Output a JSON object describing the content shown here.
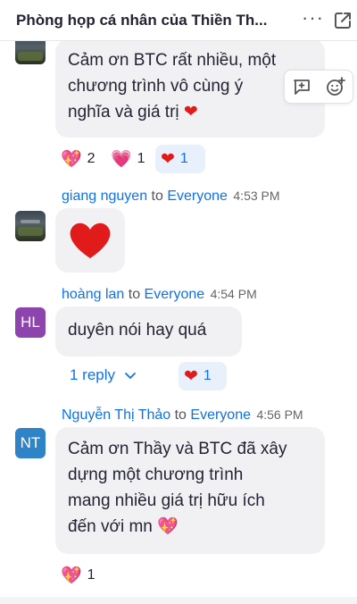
{
  "header": {
    "title": "Phòng họp cá nhân của Thiền Th...",
    "more_icon": "ellipsis-icon",
    "popout_icon": "popout-icon"
  },
  "messages": [
    {
      "text": "Cảm ơn BTC rất nhiều, một chương trình vô cùng ý nghĩa và giá trị",
      "lines": [
        "Cảm ơn BTC rất nhiều, một",
        "chương trình vô cùng ý",
        "nghĩa và giá trị"
      ],
      "end_emoji": "heart",
      "reactions": [
        {
          "emoji": "sparkling-heart",
          "count": "2"
        },
        {
          "emoji": "growing-heart",
          "count": "1"
        },
        {
          "emoji": "red-heart",
          "count": "1",
          "selected": true
        }
      ]
    },
    {
      "sender": "giang nguyen",
      "to": "to",
      "recipient": "Everyone",
      "time": "4:53 PM",
      "avatar": "photo",
      "content_emoji": "red-heart"
    },
    {
      "sender": "hoàng lan",
      "to": "to",
      "recipient": "Everyone",
      "time": "4:54 PM",
      "avatar_initials": "HL",
      "avatar_color": "#8e44ad",
      "text": "duyên nói hay quá",
      "reply_label": "1 reply",
      "reactions": [
        {
          "emoji": "red-heart",
          "count": "1",
          "selected": true
        }
      ]
    },
    {
      "sender": "Nguyễn Thị Thảo",
      "to": "to",
      "recipient": "Everyone",
      "time": "4:56 PM",
      "avatar_initials": "NT",
      "avatar_color": "#2e84c6",
      "text": "Cảm ơn Thầy và BTC đã xây dựng một chương trình mang nhiều giá trị hữu ích đến với mn",
      "lines": [
        "Cảm ơn Thầy và BTC đã xây",
        "dựng một chương trình",
        "mang nhiều giá trị hữu ích",
        "đến với mn"
      ],
      "end_emoji": "sparkling-heart",
      "reactions": [
        {
          "emoji": "sparkling-heart",
          "count": "1"
        }
      ]
    }
  ],
  "colors": {
    "accent": "#0e72ed",
    "bubble": "#f1f1f4",
    "heart": "#e11a1a"
  },
  "hover_tools": [
    "reply-icon",
    "add-reaction-icon"
  ]
}
